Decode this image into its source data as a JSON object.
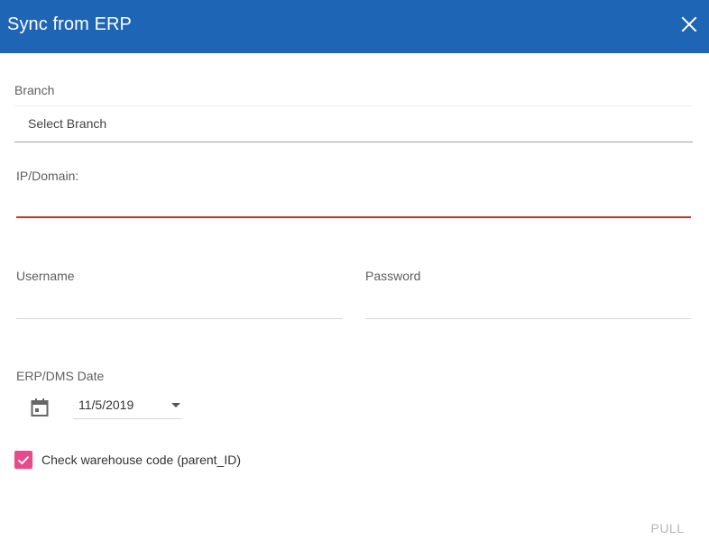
{
  "dialog": {
    "title": "Sync from ERP",
    "header_color": "#1e66b5",
    "close_icon": "close-icon"
  },
  "form": {
    "branch": {
      "label": "Branch",
      "selected_value": "Select Branch"
    },
    "ip_domain": {
      "label": "IP/Domain:",
      "value": "",
      "status": "error",
      "error_color": "#c0391b"
    },
    "username": {
      "label": "Username",
      "value": ""
    },
    "password": {
      "label": "Password",
      "value": ""
    },
    "erp_date": {
      "label": "ERP/DMS Date",
      "icon": "calendar-icon",
      "selected_value": "11/5/2019"
    },
    "check_warehouse": {
      "label": "Check warehouse code (parent_ID)",
      "checked": true,
      "color": "#e94a8a"
    }
  },
  "actions": {
    "pull_label": "PULL",
    "pull_enabled": false
  }
}
